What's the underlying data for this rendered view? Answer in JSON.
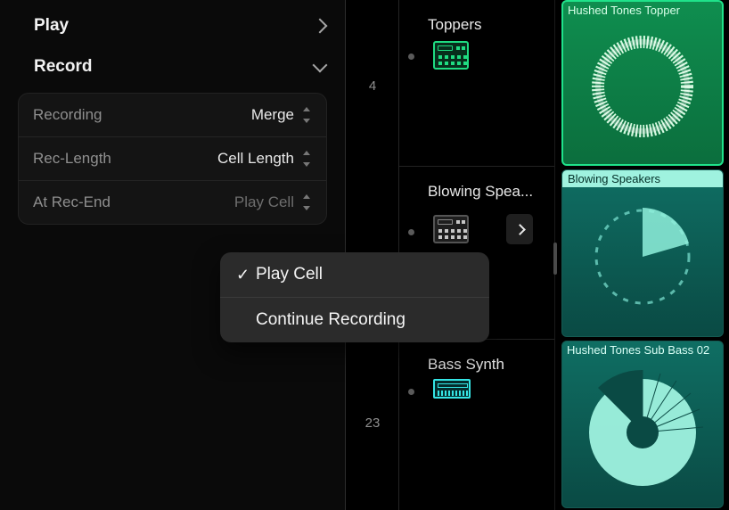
{
  "inspector": {
    "play_label": "Play",
    "record_label": "Record",
    "rows": {
      "recording": {
        "key": "Recording",
        "value": "Merge"
      },
      "reclength": {
        "key": "Rec-Length",
        "value": "Cell Length"
      },
      "atrecend": {
        "key": "At Rec-End",
        "value": "Play Cell"
      }
    }
  },
  "popup": {
    "items": [
      {
        "label": "Play Cell",
        "checked": true
      },
      {
        "label": "Continue Recording",
        "checked": false
      }
    ]
  },
  "gutter": {
    "num1": "4",
    "num2": "23"
  },
  "tracks": {
    "t1": {
      "name": "Toppers"
    },
    "t2": {
      "name": "Blowing Spea..."
    },
    "t3": {
      "name": "Bass Synth"
    }
  },
  "cells": {
    "c1": {
      "name": "Hushed Tones Topper"
    },
    "c2": {
      "name": "Blowing Speakers"
    },
    "c3": {
      "name": "Hushed Tones Sub Bass 02"
    }
  }
}
